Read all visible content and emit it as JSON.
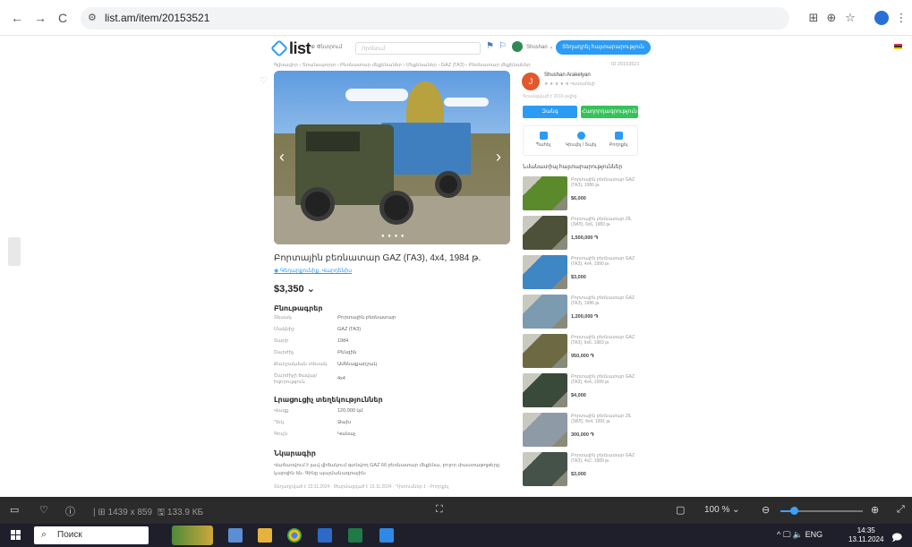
{
  "browser": {
    "url": "list.am/item/20153521",
    "nav": {
      "back": "←",
      "forward": "→",
      "reload": "C"
    },
    "icons": {
      "translate": "⊞",
      "zoom": "⊕",
      "bookmark": "☆",
      "menu": "⋮"
    }
  },
  "site": {
    "logo": "list",
    "search_button": "⊕ Փնտրում",
    "search_placeholder": "Որոնում",
    "user_label": "Shushan ⌄",
    "post_button": "Տեղադրել հայտարարություն",
    "breadcrumb": "Գլխավոր › Տրանսպորտ › Բեռնատար մեքենաներ › Մեքենաներ › GAZ (ГАЗ) › Բեռնատար մեքենաներ",
    "ad_id": "ID 20153521"
  },
  "listing": {
    "title": "Բորտային բեռնատար GAZ (ГАЗ), 4x4, 1984 թ.",
    "location": "◉ Գեղարքունիք, Վարդենիս",
    "price": "$3,350 ⌄",
    "characteristics_heading": "Բնութագրեր",
    "characteristics": [
      {
        "key": "Տեսակ",
        "value": "Բորտային բեռնատար"
      },
      {
        "key": "Մակնիշ",
        "value": "GAZ (ГАЗ)"
      },
      {
        "key": "Տարի",
        "value": "1984"
      },
      {
        "key": "Շարժիչ",
        "value": "Բենզին"
      },
      {
        "key": "Քարշակման տեսակ",
        "value": "Ամենաքարշակ"
      },
      {
        "key": "Շարժիչի ծավալ/հզորություն",
        "value": "4x4"
      }
    ],
    "extra_heading": "Լրացուցիչ տեղեկություններ",
    "extra": [
      {
        "key": "Վազք",
        "value": "120,000 կմ"
      },
      {
        "key": "Ղեկ",
        "value": "Ձախ"
      },
      {
        "key": "Գույն",
        "value": "Կանաչ"
      }
    ],
    "description_heading": "Նկարագիր",
    "description": "Վաճառվում է լավ վիճակում գտնվող GAZ 66 բեռնատար մեքենա, բոլոր փաստաթղթերը կարգին են։ Գինը պայմանագրային։",
    "footer_note": "Տեղադրված է 13.11.2024 · Թարմացված է 13.11.2024 · Դիտումներ 1 · Բողոքել"
  },
  "seller": {
    "initial": "J",
    "name": "Shushan Arakelyan",
    "sub": "★ ★ ★ ★ ★ Վստահելի",
    "since": "Գրանցված է 2016 թվից",
    "call_button": "Զանգ",
    "message_button": "Հաղորդագրություն",
    "actions": [
      {
        "label": "Պահել"
      },
      {
        "label": "Կիսվել / Տպել"
      },
      {
        "label": "Բողոքել"
      }
    ]
  },
  "similar": {
    "heading": "Նմանատիպ հայտարարություններ",
    "items": [
      {
        "title": "Բորտային բեռնատար GAZ (ГАЗ), 1986 թ.",
        "price": "$6,000",
        "color": "#5b8a2c"
      },
      {
        "title": "Բորտային բեռնատար ZIL (ЗИЛ), 6x6, 1983 թ.",
        "price": "1,500,000 ֏",
        "color": "#4d5139"
      },
      {
        "title": "Բորտային բեռնատար GAZ (ГАЗ), 4x4, 1990 թ.",
        "price": "$3,000",
        "color": "#3f86c4"
      },
      {
        "title": "Բորտային բեռնատար GAZ (ГАЗ), 1986 թ.",
        "price": "1,200,000 ֏",
        "color": "#7d9bb0"
      },
      {
        "title": "Բորտային բեռնատար GAZ (ГАЗ), 6x6, 1983 թ.",
        "price": "950,000 ֏",
        "color": "#6d6a43"
      },
      {
        "title": "Բորտային բեռնատար GAZ (ГАЗ), 4x4, 1990 թ.",
        "price": "$4,000",
        "color": "#3a4a3a"
      },
      {
        "title": "Բորտային բեռնատար ZIL (ЗИЛ), 4x4, 1991 թ.",
        "price": "300,000 ֏",
        "color": "#8e9aa6"
      },
      {
        "title": "Բորտային բեռնատար GAZ (ГАЗ), 4x2, 1989 թ.",
        "price": "$3,000",
        "color": "#44524a"
      }
    ]
  },
  "viewer": {
    "dimensions": "1439 x 859",
    "file_size": "133.9 КБ",
    "zoom": "100 %",
    "zoom_level_percent": 16
  },
  "taskbar": {
    "search_placeholder": "Поиск",
    "tray": "^ 🖵 🔈 ENG",
    "time": "14:35",
    "date": "13.11.2024"
  }
}
